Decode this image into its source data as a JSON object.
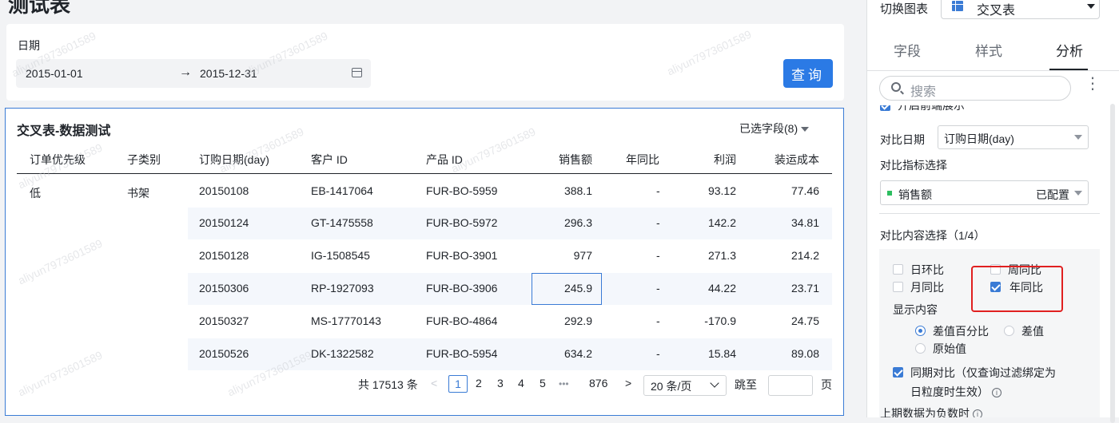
{
  "page": {
    "title": "测试表"
  },
  "filter": {
    "label": "日期",
    "start": "2015-01-01",
    "arrow": "→",
    "end": "2015-12-31",
    "query_label": "查询"
  },
  "table": {
    "title": "交叉表-数据测试",
    "selected_fields": "已选字段(8)",
    "columns": [
      "订单优先级",
      "子类别",
      "订购日期(day)",
      "客户 ID",
      "产品 ID",
      "销售额",
      "年同比",
      "利润",
      "装运成本"
    ],
    "group": {
      "priority": "低",
      "subcategory": "书架"
    },
    "rows": [
      {
        "date": "20150108",
        "customer": "EB-1417064",
        "product": "FUR-BO-5959",
        "sales": "388.1",
        "yoy": "-",
        "profit": "93.12",
        "ship": "77.46"
      },
      {
        "date": "20150124",
        "customer": "GT-1475558",
        "product": "FUR-BO-5972",
        "sales": "296.3",
        "yoy": "-",
        "profit": "142.2",
        "ship": "34.81"
      },
      {
        "date": "20150128",
        "customer": "IG-1508545",
        "product": "FUR-BO-3901",
        "sales": "977",
        "yoy": "-",
        "profit": "271.3",
        "ship": "214.2"
      },
      {
        "date": "20150306",
        "customer": "RP-1927093",
        "product": "FUR-BO-3906",
        "sales": "245.9",
        "yoy": "-",
        "profit": "44.22",
        "ship": "23.71"
      },
      {
        "date": "20150327",
        "customer": "MS-17770143",
        "product": "FUR-BO-4864",
        "sales": "292.9",
        "yoy": "-",
        "profit": "-170.9",
        "ship": "24.75"
      },
      {
        "date": "20150526",
        "customer": "DK-1322582",
        "product": "FUR-BO-5954",
        "sales": "634.2",
        "yoy": "-",
        "profit": "15.84",
        "ship": "89.08"
      }
    ],
    "pagination": {
      "total": "共 17513 条",
      "prev": "<",
      "pages": [
        "1",
        "2",
        "3",
        "4",
        "5"
      ],
      "active": "1",
      "ellipsis": "•••",
      "last": "876",
      "next": ">",
      "page_size": "20 条/页",
      "jump_label": "跳至",
      "page_suffix": "页"
    }
  },
  "watermark": "aliyun7973601589",
  "panel": {
    "switch_label": "切换图表",
    "chart_type": "交叉表",
    "tabs": [
      "字段",
      "样式",
      "分析"
    ],
    "active_tab": "分析",
    "search_placeholder": "搜索",
    "more": "⋮",
    "partial_top": "开启前端展示",
    "compare_date_label": "对比日期",
    "compare_date_value": "订购日期(day)",
    "metric_label": "对比指标选择",
    "metric_value": "销售额",
    "metric_status": "已配置",
    "content_label": "对比内容选择（1/4）",
    "options": [
      {
        "label": "日环比",
        "checked": false
      },
      {
        "label": "周同比",
        "checked": false
      },
      {
        "label": "月同比",
        "checked": false
      },
      {
        "label": "年同比",
        "checked": true
      }
    ],
    "display_label": "显示内容",
    "display_options": [
      {
        "label": "差值百分比",
        "selected": true
      },
      {
        "label": "差值",
        "selected": false
      },
      {
        "label": "原始值",
        "selected": false
      }
    ],
    "period_line1": "同期对比（仅查询过滤绑定为",
    "period_line2": "日粒度时生效）",
    "negative_label": "上期数据为负数时",
    "info": "i"
  },
  "colors": {
    "accent": "#2b7ae5",
    "highlight": "#e02020",
    "metric_dot": "#2dbe60"
  }
}
